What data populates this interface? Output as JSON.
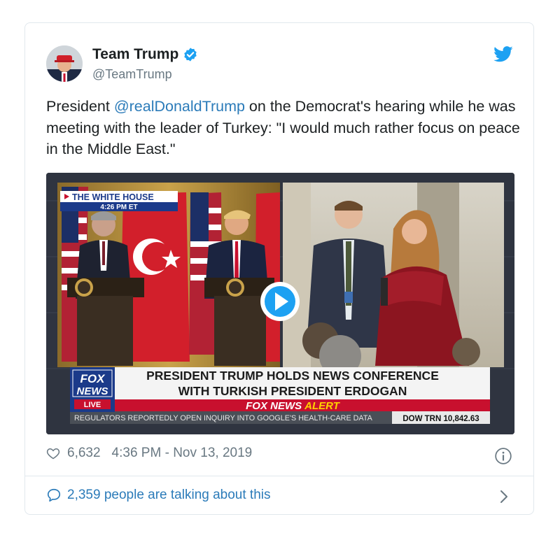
{
  "tweet": {
    "author_name": "Team Trump",
    "author_handle": "@TeamTrump",
    "text_before": "President ",
    "mention": "@realDonaldTrump",
    "text_after": " on the Democrat's hearing while he was meeting with the leader of Turkey: \"I would much rather focus on peace in the Middle East.\"",
    "likes": "6,632",
    "timestamp": "4:36 PM - Nov 13, 2019",
    "talking": "2,359 people are talking about this"
  },
  "video": {
    "location_tag": "THE WHITE HOUSE",
    "location_time": "4:26 PM ET",
    "headline_line1": "PRESIDENT TRUMP HOLDS NEWS CONFERENCE",
    "headline_line2": "WITH TURKISH PRESIDENT ERDOGAN",
    "alert": "FOX NEWS ALERT",
    "alert_part1": "FOX NEWS",
    "alert_part2": "ALERT",
    "ticker": "REGULATORS REPORTEDLY OPEN INQUIRY INTO GOOGLE'S HEALTH-CARE DATA",
    "dow": "DOW TRN 10,842.63",
    "logo_fox": "FOX",
    "logo_news": "NEWS",
    "logo_live": "LIVE"
  },
  "colors": {
    "link": "#2b7bb9",
    "verified": "#1da1f2",
    "fox_red": "#c8102e",
    "fox_blue": "#1b3a8a"
  },
  "icons": [
    "verified-badge-icon",
    "twitter-bird-icon",
    "play-icon",
    "heart-icon",
    "info-icon",
    "speech-bubble-icon",
    "chevron-right-icon"
  ]
}
